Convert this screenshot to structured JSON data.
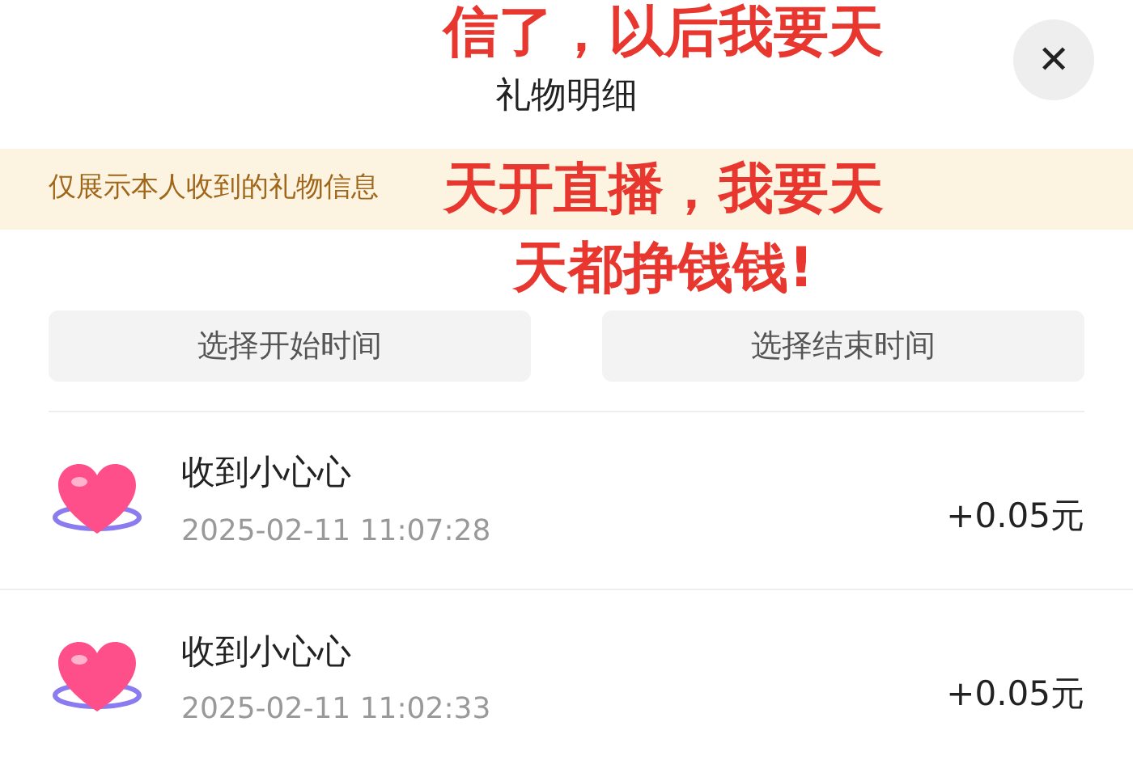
{
  "header": {
    "title": "礼物明细",
    "close": "✕"
  },
  "notice": "仅展示本人收到的礼物信息",
  "date_buttons": [
    {
      "label": "选择开始时间"
    },
    {
      "label": "选择结束时间"
    }
  ],
  "records": [
    {
      "title": "收到小心心",
      "time": "2025-02-11 11:07:28",
      "amount": "+0.05元"
    },
    {
      "title": "收到小心心",
      "time": "2025-02-11 11:02:33",
      "amount": "+0.05元"
    }
  ],
  "caption": [
    "信了，以后我要天",
    "天开直播，我要天",
    "天都挣钱钱!"
  ]
}
